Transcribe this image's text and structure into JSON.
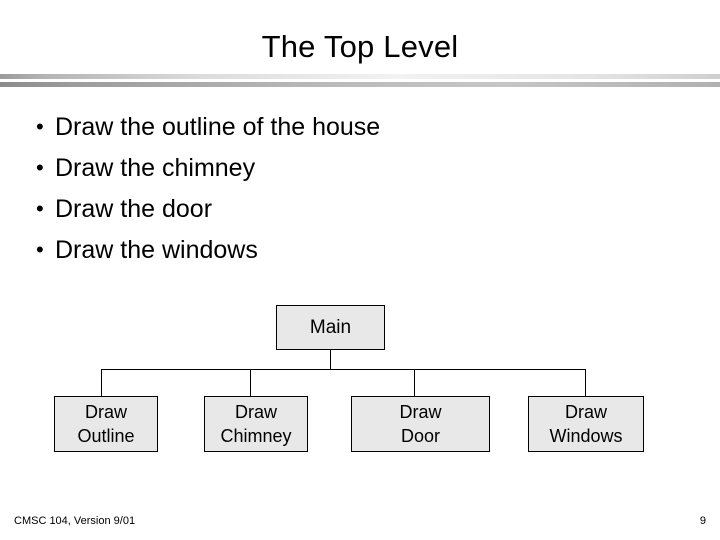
{
  "slide": {
    "title": "The Top Level",
    "colors": {
      "background": "#ffffff",
      "text": "#000000",
      "box_fill": "#e8e8e8",
      "box_border": "#000000",
      "divider_light": "#f2f2f2",
      "divider_dark": "#8b8b8b"
    }
  },
  "bullets": [
    {
      "marker": "•",
      "text": "Draw the outline of the house"
    },
    {
      "marker": "•",
      "text": "Draw the chimney"
    },
    {
      "marker": "•",
      "text": "Draw the door"
    },
    {
      "marker": "•",
      "text": "Draw the windows"
    }
  ],
  "diagram": {
    "root": {
      "label": "Main"
    },
    "children": [
      {
        "line1": "Draw",
        "line2": "Outline"
      },
      {
        "line1": "Draw",
        "line2": "Chimney"
      },
      {
        "line1": "Draw",
        "line2": "Door"
      },
      {
        "line1": "Draw",
        "line2": "Windows"
      }
    ]
  },
  "footer": {
    "course": "CMSC 104, Version 9/01",
    "page_number": "9"
  }
}
